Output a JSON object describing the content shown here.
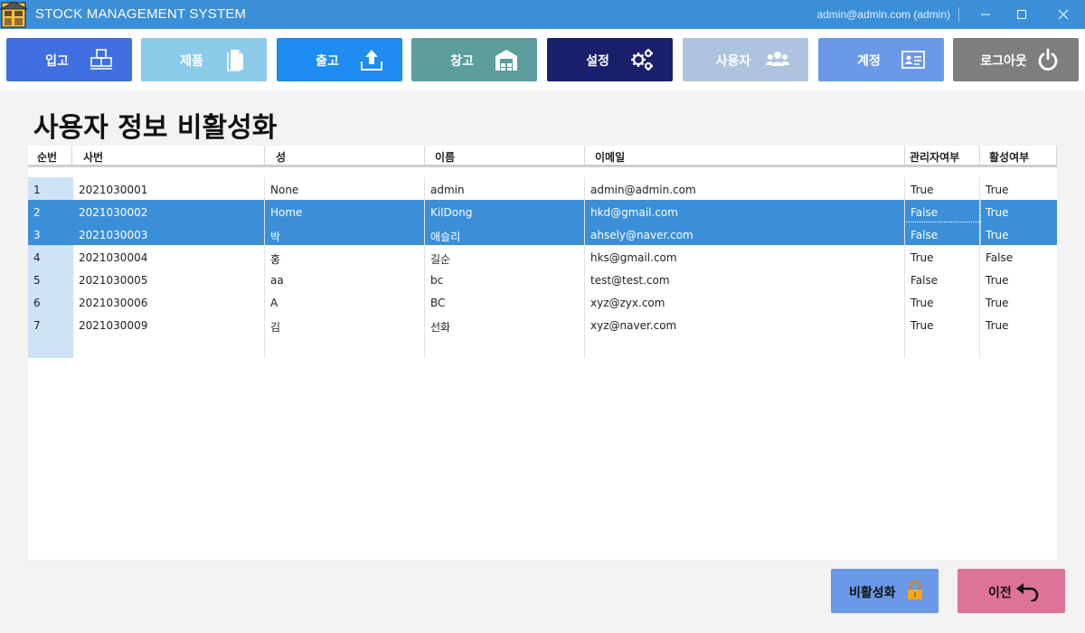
{
  "window": {
    "app_title": "STOCK MANAGEMENT SYSTEM",
    "account": "admin@admin.com (admin)"
  },
  "nav": [
    {
      "label": "입고",
      "icon": "receive-box-icon",
      "color": "#3f6fe0"
    },
    {
      "label": "제품",
      "icon": "document-icon",
      "color": "#8bcbe9"
    },
    {
      "label": "출고",
      "icon": "upload-tray-icon",
      "color": "#1e8cf0"
    },
    {
      "label": "창고",
      "icon": "warehouse-icon",
      "color": "#5b9e9c"
    },
    {
      "label": "설정",
      "icon": "gears-icon",
      "color": "#1a1f6b"
    },
    {
      "label": "사용자",
      "icon": "users-icon",
      "color": "#aec3de"
    },
    {
      "label": "계정",
      "icon": "id-card-icon",
      "color": "#6a99e8"
    },
    {
      "label": "로그아웃",
      "icon": "power-icon",
      "color": "#7e7e7e"
    }
  ],
  "page": {
    "title": "사용자 정보 비활성화"
  },
  "table": {
    "columns": [
      "순번",
      "사번",
      "성",
      "이름",
      "이메일",
      "관리자여부",
      "활성여부"
    ],
    "rows": [
      {
        "no": "1",
        "emp_id": "2021030001",
        "last": "None",
        "first": "admin",
        "email": "admin@admin.com",
        "is_admin": "True",
        "active": "True",
        "selected": false
      },
      {
        "no": "2",
        "emp_id": "2021030002",
        "last": "Home",
        "first": "KilDong",
        "email": "hkd@gmail.com",
        "is_admin": "False",
        "active": "True",
        "selected": true
      },
      {
        "no": "3",
        "emp_id": "2021030003",
        "last": "박",
        "first": "애슬리",
        "email": "ahsely@naver.com",
        "is_admin": "False",
        "active": "True",
        "selected": true
      },
      {
        "no": "4",
        "emp_id": "2021030004",
        "last": "홍",
        "first": "길순",
        "email": "hks@gmail.com",
        "is_admin": "True",
        "active": "False",
        "selected": false
      },
      {
        "no": "5",
        "emp_id": "2021030005",
        "last": "aa",
        "first": "bc",
        "email": "test@test.com",
        "is_admin": "False",
        "active": "True",
        "selected": false
      },
      {
        "no": "6",
        "emp_id": "2021030006",
        "last": "A",
        "first": "BC",
        "email": "xyz@zyx.com",
        "is_admin": "True",
        "active": "True",
        "selected": false
      },
      {
        "no": "7",
        "emp_id": "2021030009",
        "last": "김",
        "first": "선화",
        "email": "xyz@naver.com",
        "is_admin": "True",
        "active": "True",
        "selected": false
      }
    ]
  },
  "actions": {
    "deactivate_label": "비활성화",
    "deactivate_color": "#6a99e8",
    "back_label": "이전",
    "back_color": "#df7396"
  }
}
